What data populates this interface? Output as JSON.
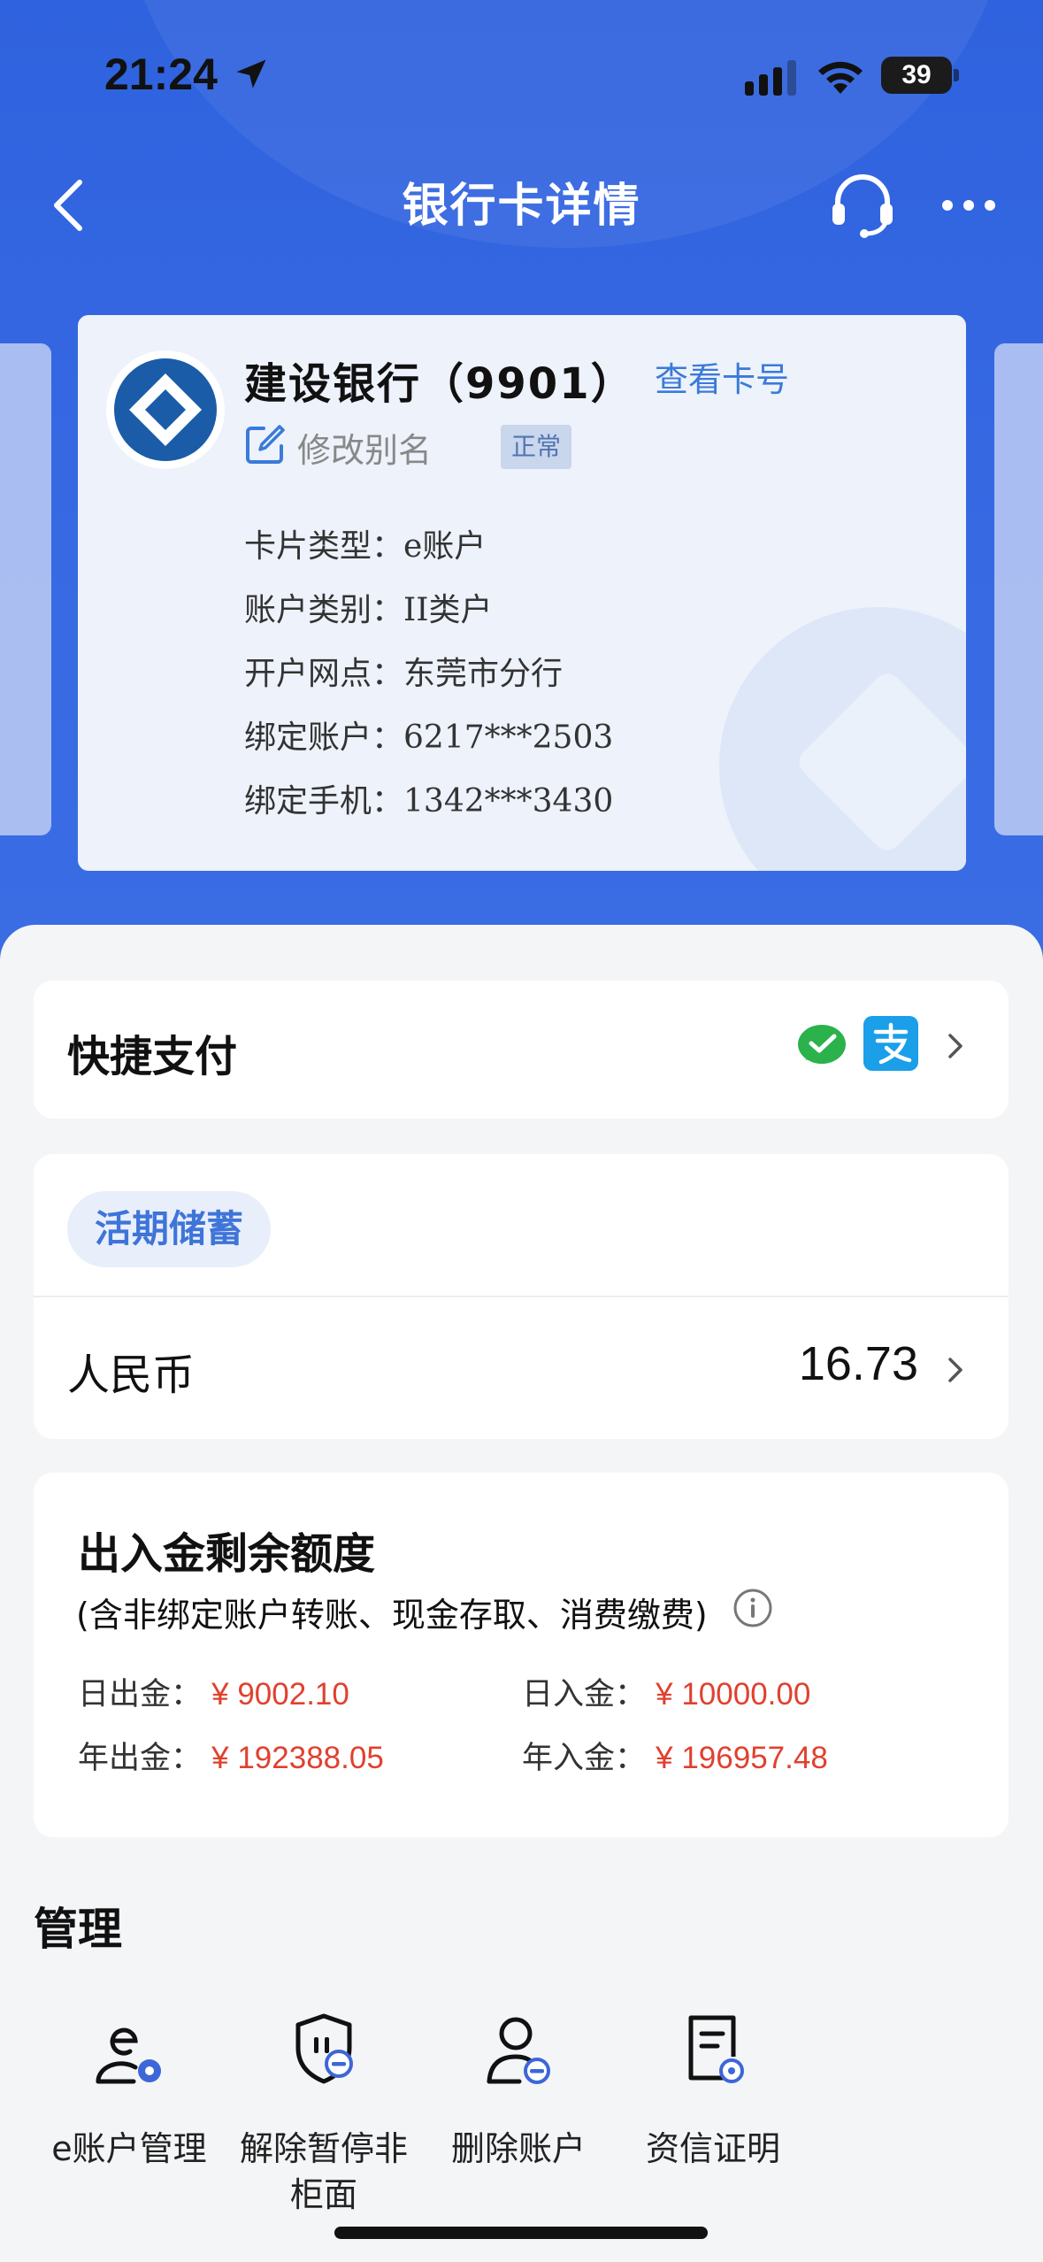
{
  "status_bar": {
    "time": "21:24",
    "battery": "39"
  },
  "nav": {
    "title": "银行卡详情"
  },
  "card": {
    "bank_name": "建设银行（9901）",
    "view_card_number": "查看卡号",
    "edit_alias": "修改别名",
    "status": "正常",
    "details": [
      {
        "label": "卡片类型：",
        "value": "e账户"
      },
      {
        "label": "账户类别：",
        "value": "II类户"
      },
      {
        "label": "开户网点：",
        "value": "东莞市分行"
      },
      {
        "label": "绑定账户：",
        "value": "6217***2503"
      },
      {
        "label": "绑定手机：",
        "value": "1342***3430"
      }
    ]
  },
  "quick_pay": {
    "label": "快捷支付"
  },
  "deposit": {
    "tag": "活期储蓄",
    "currency": "人民币",
    "balance": "16.73"
  },
  "quota": {
    "title": "出入金剩余额度",
    "subtitle": "(含非绑定账户转账、现金存取、消费缴费)",
    "items": [
      {
        "label": "日出金：",
        "amount": "¥  9002.10"
      },
      {
        "label": "日入金：",
        "amount": "¥  10000.00"
      },
      {
        "label": "年出金：",
        "amount": "¥  192388.05"
      },
      {
        "label": "年入金：",
        "amount": "¥  196957.48"
      }
    ]
  },
  "management": {
    "title": "管理",
    "items": [
      {
        "label": "e账户管理"
      },
      {
        "label": "解除暂停非柜面"
      },
      {
        "label": "删除账户"
      },
      {
        "label": "资信证明"
      }
    ]
  },
  "colors": {
    "hero_blue": "#3368e0",
    "link_blue": "#3b7ad9",
    "amount_red": "#e0412f",
    "icon_blue": "#3d66d8"
  }
}
